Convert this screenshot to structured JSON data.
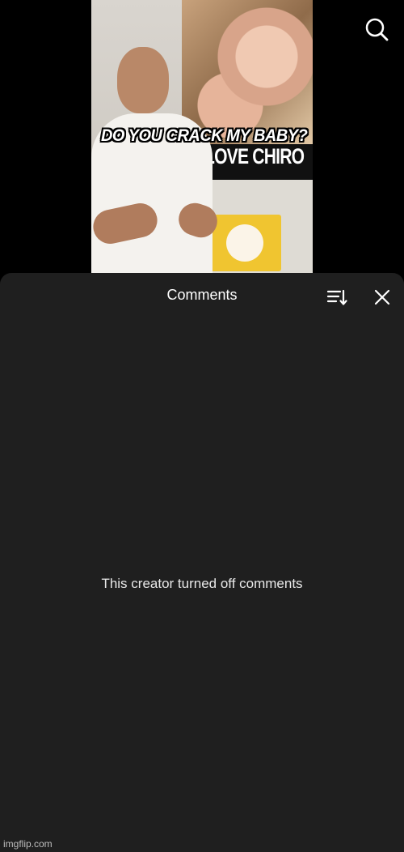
{
  "video": {
    "caption": "DO YOU CRACK MY BABY?",
    "poster_text": "LOVE CHIRO"
  },
  "header": {
    "search_icon": "search-icon"
  },
  "comments_sheet": {
    "title": "Comments",
    "sort_icon": "sort-icon",
    "close_icon": "close-icon",
    "empty_message": "This creator turned off comments"
  },
  "watermark": "imgflip.com",
  "colors": {
    "sheet_background": "#1f1f1f",
    "page_background": "#000000",
    "text_primary": "#ffffff"
  }
}
